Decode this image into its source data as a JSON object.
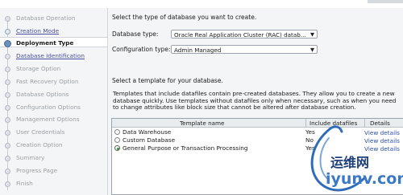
{
  "sidebar": {
    "steps": [
      {
        "label": "Database Operation",
        "state": "disabled"
      },
      {
        "label": "Creation Mode",
        "state": "link"
      },
      {
        "label": "Deployment Type",
        "state": "active"
      },
      {
        "label": "Database Identification",
        "state": "link"
      },
      {
        "label": "Storage Option",
        "state": "disabled"
      },
      {
        "label": "Fast Recovery Option",
        "state": "disabled"
      },
      {
        "label": "Database Options",
        "state": "disabled"
      },
      {
        "label": "Configuration Options",
        "state": "disabled"
      },
      {
        "label": "Management Options",
        "state": "disabled"
      },
      {
        "label": "User Credentials",
        "state": "disabled"
      },
      {
        "label": "Creation Option",
        "state": "disabled"
      },
      {
        "label": "Summary",
        "state": "disabled"
      },
      {
        "label": "Progress Page",
        "state": "disabled"
      },
      {
        "label": "Finish",
        "state": "disabled"
      }
    ]
  },
  "deployment": {
    "instruction": "Select the type of database you want to create.",
    "database_type_label": "Database type:",
    "database_type_value": "Oracle Real Application Cluster (RAC) datab...",
    "configuration_type_label": "Configuration type:",
    "configuration_type_value": "Admin Managed"
  },
  "templates": {
    "heading": "Select a template for your database.",
    "description": "Templates that include datafiles contain pre-created databases. They allow you to create a new database quickly. Use templates without datafiles only when necessary, such as when you need to change attributes like block size that cannot be altered after database creation.",
    "columns": [
      "Template name",
      "Include datafiles",
      "Details"
    ],
    "rows": [
      {
        "name": "Data Warehouse",
        "include_datafiles": "Yes",
        "details": "View details",
        "selected": false
      },
      {
        "name": "Custom Database",
        "include_datafiles": "No",
        "details": "View details",
        "selected": false
      },
      {
        "name": "General Purpose or Transaction Processing",
        "include_datafiles": "Yes",
        "details": "View details",
        "selected": true
      }
    ]
  },
  "watermark": {
    "chinese": "运维网",
    "latin": "iyunv.com"
  },
  "colors": {
    "active_step_dot": "#6d8fb8",
    "link": "#2b4ea8",
    "watermark": "#2f5fa8"
  }
}
